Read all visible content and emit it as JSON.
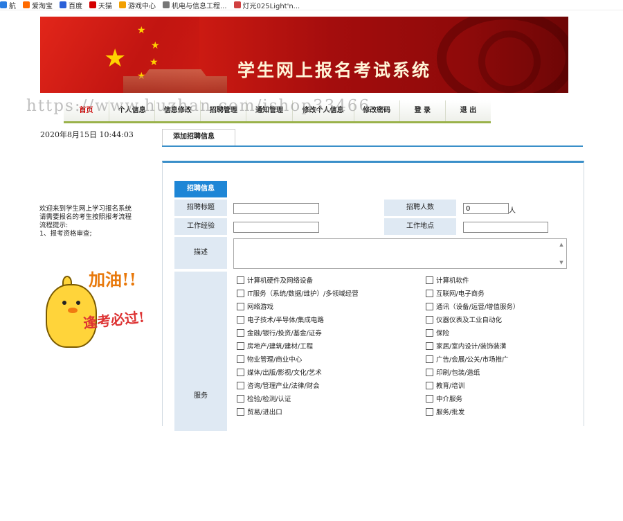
{
  "bookmarks": [
    {
      "label": "航",
      "color": "#2a7be0"
    },
    {
      "label": "爱淘宝",
      "color": "#ff6a00"
    },
    {
      "label": "百度",
      "color": "#2a60d8"
    },
    {
      "label": "天猫",
      "color": "#d40000"
    },
    {
      "label": "游戏中心",
      "color": "#f2a000"
    },
    {
      "label": "机电与信息工程...",
      "color": "#777777"
    },
    {
      "label": "灯光025Light'n...",
      "color": "#d04040"
    }
  ],
  "banner": {
    "title": "学生网上报名考试系统"
  },
  "watermark": "https://www.huzhan.com/ishop33466",
  "nav": [
    "首页",
    "个人信息",
    "信息修改",
    "招聘管理",
    "通知管理",
    "修改个人信息",
    "修改密码",
    "登 录",
    "退 出"
  ],
  "datetime": "2020年8月15日  10:44:03",
  "welcome": [
    "欢迎来到学生网上学习报名系统",
    "请需要报名的考生按照报考流程",
    "流程提示:",
    "1、报考资格审查;"
  ],
  "cheer": {
    "line1": "加油!!",
    "line2": "逢考必过!"
  },
  "tab": {
    "label": "添加招聘信息"
  },
  "form": {
    "section": "招聘信息",
    "title_label": "招聘标题",
    "title_value": "",
    "count_label": "招聘人数",
    "count_value": "0",
    "count_unit": "人",
    "exp_label": "工作经验",
    "exp_value": "",
    "place_label": "工作地点",
    "place_value": "",
    "desc_label": "描述",
    "service_label": "服务"
  },
  "services_left": [
    "计算机硬件及网络设备",
    "IT服务（系统/数据/维护）/多领域经营",
    "网络游戏",
    "电子技术/半导体/集成电路",
    "金融/银行/投资/基金/证券",
    "房地产/建筑/建材/工程",
    "物业管理/商业中心",
    "媒体/出版/影视/文化/艺术",
    "咨询/管理产业/法律/财会",
    "检验/检测/认证",
    "贸易/进出口"
  ],
  "services_right": [
    "计算机软件",
    "互联网/电子商务",
    "通讯（设备/运营/增值服务）",
    "仪器仪表及工业自动化",
    "保险",
    "家居/室内设计/装饰装潢",
    "广告/会展/公关/市场推广",
    "印刷/包装/造纸",
    "教育/培训",
    "中介服务",
    "服务/批发"
  ]
}
